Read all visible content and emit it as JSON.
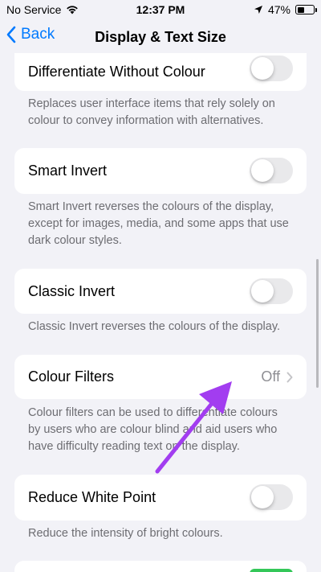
{
  "status": {
    "carrier": "No Service",
    "time": "12:37 PM",
    "battery_percent": "47%",
    "battery_level": 0.47
  },
  "nav": {
    "back_label": "Back",
    "title": "Display & Text Size"
  },
  "settings": [
    {
      "label": "Differentiate Without Colour",
      "toggle_on": false,
      "description": "Replaces user interface items that rely solely on colour to convey information with alternatives."
    },
    {
      "label": "Smart Invert",
      "toggle_on": false,
      "description": "Smart Invert reverses the colours of the display, except for images, media, and some apps that use dark colour styles."
    },
    {
      "label": "Classic Invert",
      "toggle_on": false,
      "description": "Classic Invert reverses the colours of the display."
    },
    {
      "label": "Colour Filters",
      "value": "Off",
      "description": "Colour filters can be used to differentiate colours by users who are colour blind and aid users who have difficulty reading text on the display."
    },
    {
      "label": "Reduce White Point",
      "toggle_on": false,
      "description": "Reduce the intensity of bright colours."
    }
  ],
  "colors": {
    "accent": "#007aff",
    "annotation_arrow": "#a23df0",
    "toggle_off": "#e9e9eb",
    "toggle_on": "#34c759"
  }
}
